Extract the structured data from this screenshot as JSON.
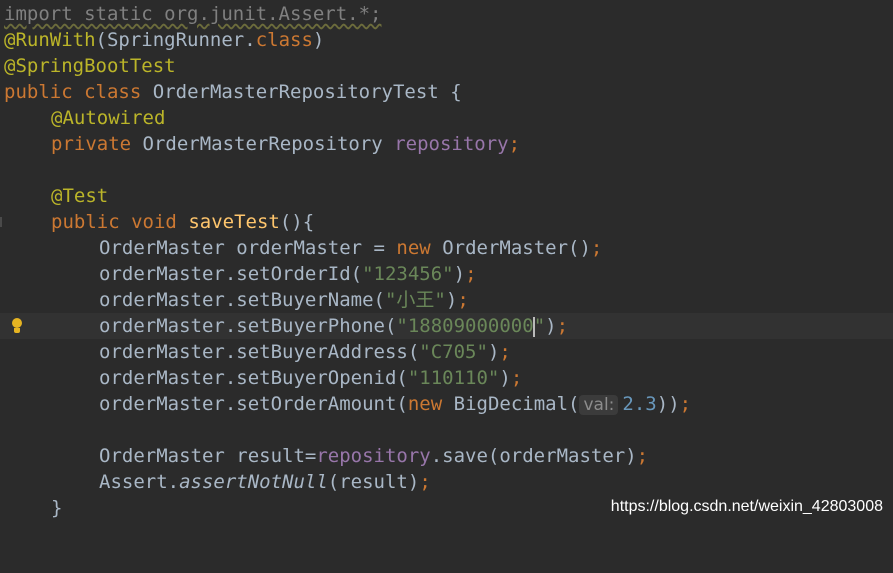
{
  "code": {
    "l1": {
      "import_line": "import static org.junit.Assert.*;"
    },
    "l2": {
      "anno": "@RunWith",
      "open": "(",
      "cls": "SpringRunner",
      "dot": ".",
      "kw": "class",
      "close": ")"
    },
    "l3": {
      "anno": "@SpringBootTest"
    },
    "l4": {
      "kw1": "public",
      "kw2": "class",
      "name": "OrderMasterRepositoryTest",
      "brace": "{"
    },
    "l5": {
      "anno": "@Autowired"
    },
    "l6": {
      "kw": "private",
      "type": "OrderMasterRepository",
      "field": "repository",
      "semi": ";"
    },
    "l8": {
      "anno": "@Test"
    },
    "l9": {
      "kw1": "public",
      "kw2": "void",
      "method": "saveTest",
      "rest": "(){"
    },
    "l10": {
      "decl": "OrderMaster orderMaster = ",
      "kw": "new",
      "ctor": "OrderMaster()",
      "semi": ";"
    },
    "l11": {
      "call": "orderMaster.setOrderId(",
      "str": "\"123456\"",
      "close": ")",
      "semi": ";"
    },
    "l12": {
      "call": "orderMaster.setBuyerName(",
      "str": "\"小王\"",
      "close": ")",
      "semi": ";"
    },
    "l13": {
      "call": "orderMaster.setBuyerPhone(",
      "str_a": "\"18809000000",
      "str_b": "\"",
      "close": ")",
      "semi": ";"
    },
    "l14": {
      "call": "orderMaster.setBuyerAddress(",
      "str": "\"C705\"",
      "close": ")",
      "semi": ";"
    },
    "l15": {
      "call": "orderMaster.setBuyerOpenid(",
      "str": "\"110110\"",
      "close": ")",
      "semi": ";"
    },
    "l16": {
      "call": "orderMaster.setOrderAmount(",
      "kw": "new",
      "ctor": "BigDecimal(",
      "hint": "val:",
      "num": "2.3",
      "close": "))",
      "semi": ";"
    },
    "l18": {
      "decl": "OrderMaster result=",
      "field": "repository",
      "call": ".save(orderMaster)",
      "semi": ";"
    },
    "l19": {
      "cls": "Assert.",
      "method": "assertNotNull",
      "args": "(result)",
      "semi": ";"
    },
    "l20": {
      "brace": "}"
    }
  },
  "watermark": "https://blog.csdn.net/weixin_42803008",
  "colors": {
    "background": "#2b2b2b",
    "keyword": "#cc7832",
    "annotation": "#bbb529",
    "field": "#9876aa",
    "method_decl": "#ffc66d",
    "string": "#6a8759",
    "number": "#6897bb",
    "text": "#a9b7c6"
  },
  "icons": {
    "intention": "lightbulb-icon"
  }
}
